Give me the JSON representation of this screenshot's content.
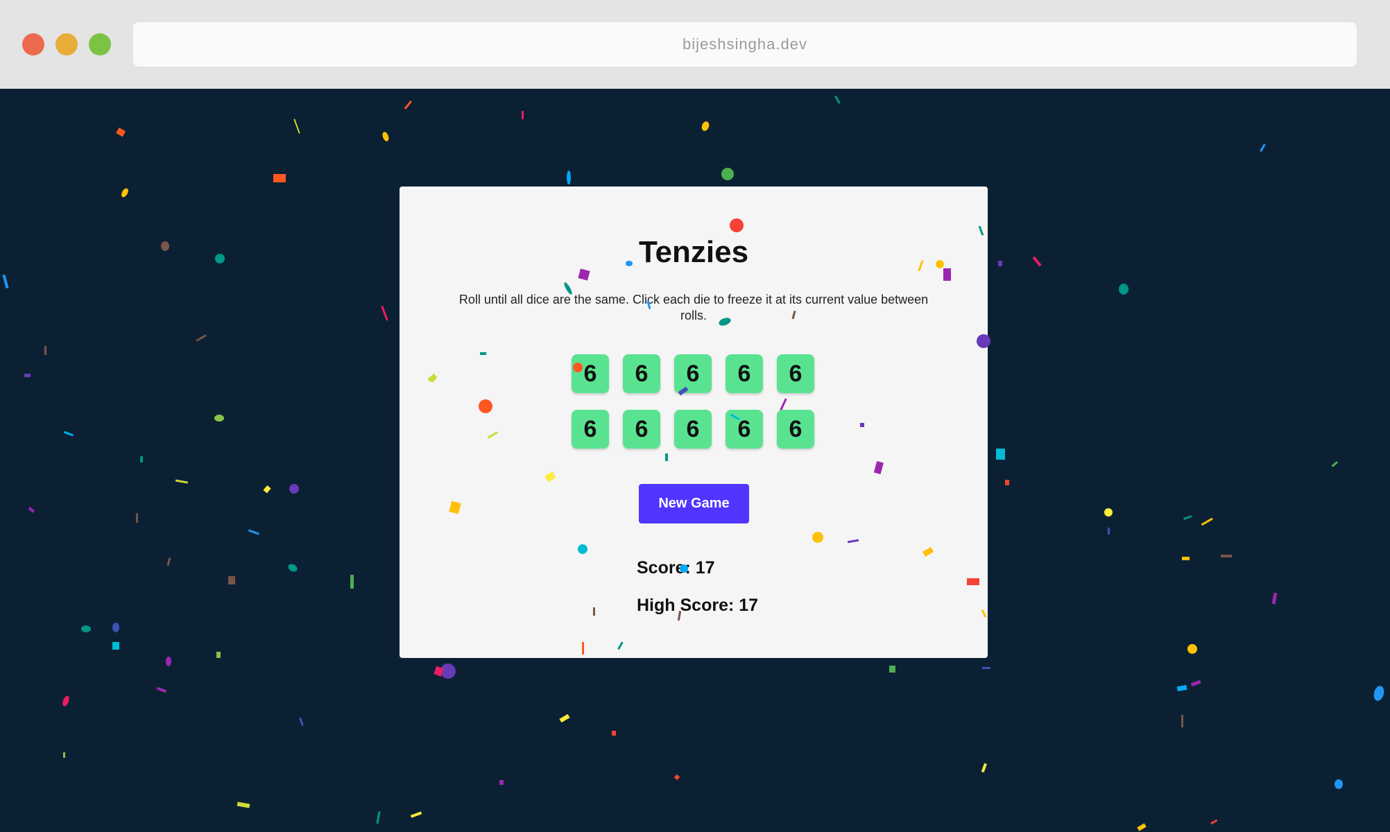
{
  "browser": {
    "url": "bijeshsingha.dev"
  },
  "game": {
    "title": "Tenzies",
    "instructions": "Roll until all dice are the same. Click each die to freeze it at its current value between rolls.",
    "dice": [
      "6",
      "6",
      "6",
      "6",
      "6",
      "6",
      "6",
      "6",
      "6",
      "6"
    ],
    "new_game_label": "New Game",
    "score_text": "Score: 17",
    "high_score_text": "High Score: 17"
  },
  "colors": {
    "background": "#0b2133",
    "card": "#f5f5f5",
    "die_held": "#59e391",
    "button": "#5035ff"
  }
}
